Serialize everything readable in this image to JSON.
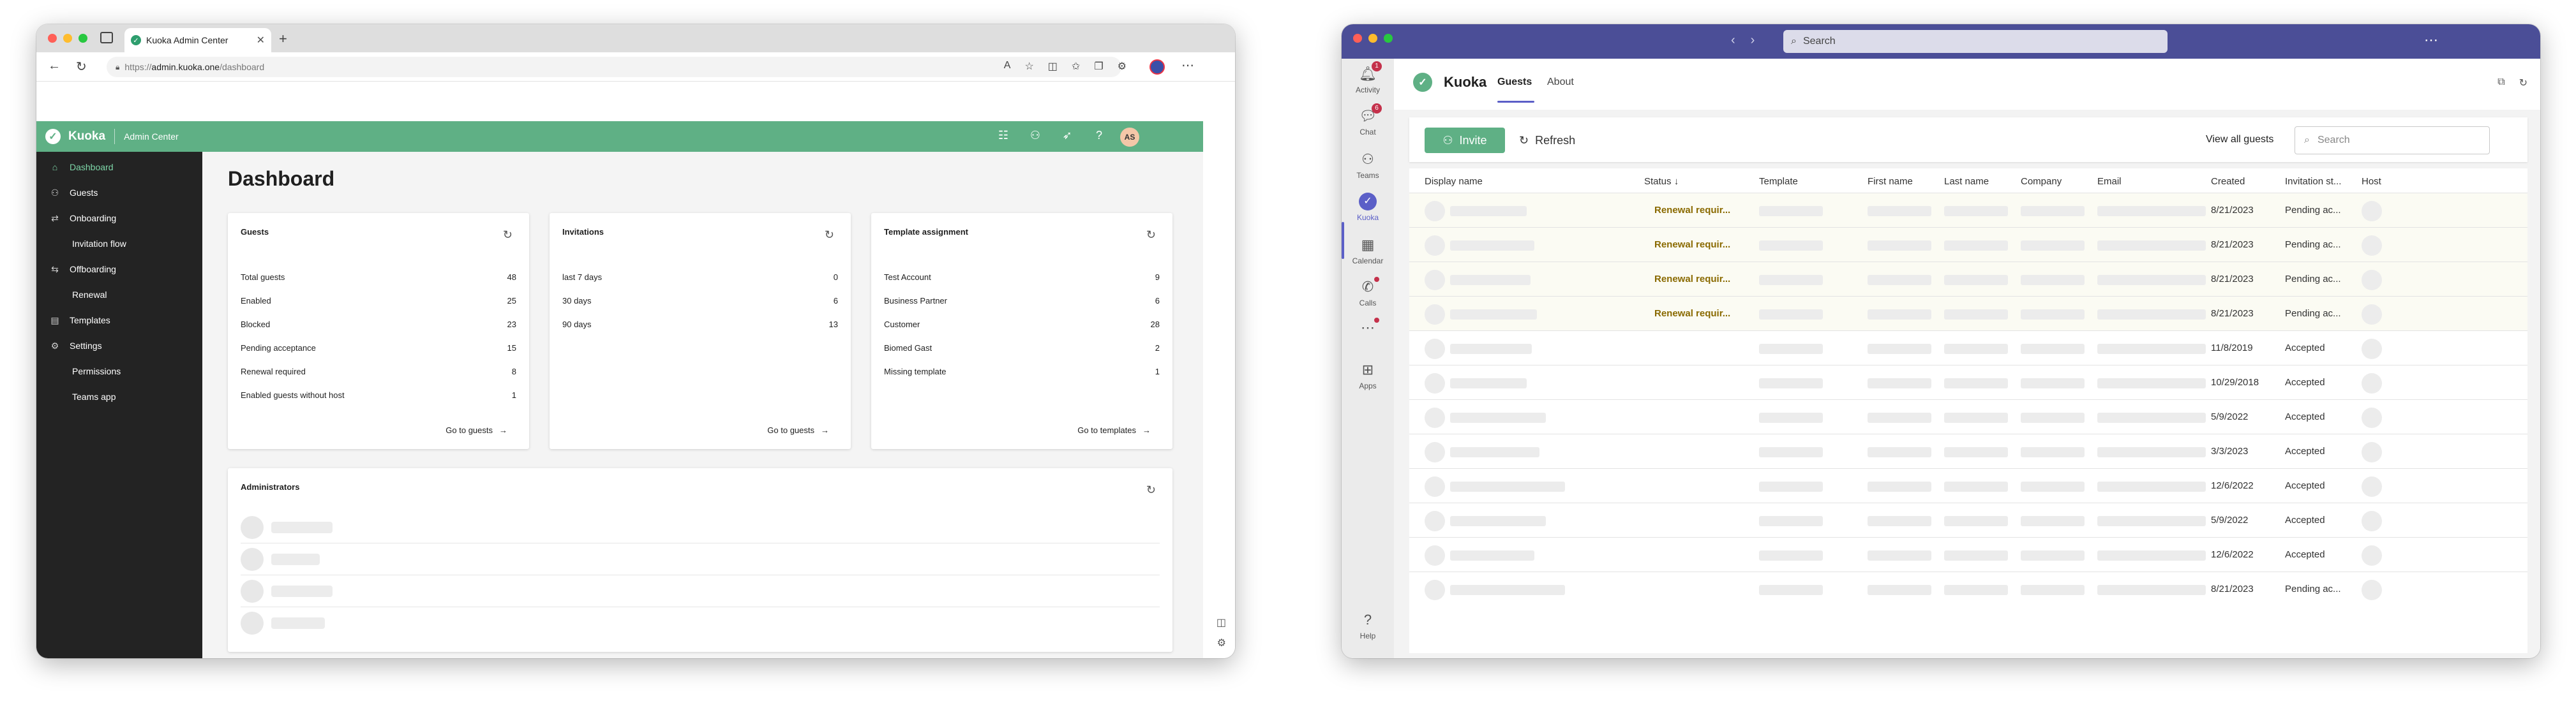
{
  "browser": {
    "tab_title": "Kuoka Admin Center",
    "url_protocol": "https://",
    "url_host": "admin.kuoka.one",
    "url_path": "/dashboard"
  },
  "admin": {
    "brand": "Kuoka",
    "subtitle": "Admin Center",
    "avatar_initials": "AS",
    "sidebar": [
      {
        "label": "Dashboard",
        "icon": "home-icon",
        "sub": false,
        "active": true
      },
      {
        "label": "Guests",
        "icon": "guests-icon",
        "sub": false,
        "active": false
      },
      {
        "label": "Onboarding",
        "icon": "onboarding-icon",
        "sub": false,
        "active": false
      },
      {
        "label": "Invitation flow",
        "icon": "",
        "sub": true,
        "active": false
      },
      {
        "label": "Offboarding",
        "icon": "offboarding-icon",
        "sub": false,
        "active": false
      },
      {
        "label": "Renewal",
        "icon": "",
        "sub": true,
        "active": false
      },
      {
        "label": "Templates",
        "icon": "templates-icon",
        "sub": false,
        "active": false
      },
      {
        "label": "Settings",
        "icon": "gear-icon",
        "sub": false,
        "active": false
      },
      {
        "label": "Permissions",
        "icon": "",
        "sub": true,
        "active": false
      },
      {
        "label": "Teams app",
        "icon": "",
        "sub": true,
        "active": false
      }
    ],
    "page_title": "Dashboard",
    "cards": [
      {
        "title": "Guests",
        "rows": [
          {
            "label": "Total guests",
            "value": "48"
          },
          {
            "label": "Enabled",
            "value": "25"
          },
          {
            "label": "Blocked",
            "value": "23"
          },
          {
            "label": "Pending acceptance",
            "value": "15"
          },
          {
            "label": "Renewal required",
            "value": "8"
          },
          {
            "label": "Enabled guests without host",
            "value": "1"
          }
        ],
        "link": "Go to guests"
      },
      {
        "title": "Invitations",
        "rows": [
          {
            "label": "last 7 days",
            "value": "0"
          },
          {
            "label": "30 days",
            "value": "6"
          },
          {
            "label": "90 days",
            "value": "13"
          }
        ],
        "link": "Go to guests"
      },
      {
        "title": "Template assignment",
        "rows": [
          {
            "label": "Test Account",
            "value": "9"
          },
          {
            "label": "Business Partner",
            "value": "6"
          },
          {
            "label": "Customer",
            "value": "28"
          },
          {
            "label": "Biomed Gast",
            "value": "2"
          },
          {
            "label": "Missing template",
            "value": "1"
          }
        ],
        "link": "Go to templates"
      }
    ],
    "administrators_title": "Administrators"
  },
  "teams": {
    "search_placeholder": "Search",
    "rail": [
      {
        "label": "Activity",
        "icon": "bell-icon",
        "badge": "1"
      },
      {
        "label": "Chat",
        "icon": "chat-icon",
        "badge": "6"
      },
      {
        "label": "Teams",
        "icon": "teams-icon",
        "badge": ""
      },
      {
        "label": "Kuoka",
        "icon": "kuoka-icon",
        "badge": ""
      },
      {
        "label": "Calendar",
        "icon": "calendar-icon",
        "badge": ""
      },
      {
        "label": "Calls",
        "icon": "phone-icon",
        "badge": ""
      },
      {
        "label": "",
        "icon": "more-icon",
        "badge": ""
      },
      {
        "label": "Apps",
        "icon": "apps-icon",
        "badge": ""
      }
    ],
    "help_label": "Help",
    "app_name": "Kuoka",
    "tabs": [
      "Guests",
      "About"
    ],
    "invite_label": "Invite",
    "refresh_label": "Refresh",
    "view_all_label": "View all guests",
    "table_search_placeholder": "Search",
    "columns": [
      "Display name",
      "Status ↓",
      "Template",
      "First name",
      "Last name",
      "Company",
      "Email",
      "Created",
      "Invitation st...",
      "Host"
    ],
    "rows": [
      {
        "status": "Renewal requir...",
        "created": "8/21/2023",
        "invitation": "Pending ac..."
      },
      {
        "status": "Renewal requir...",
        "created": "8/21/2023",
        "invitation": "Pending ac..."
      },
      {
        "status": "Renewal requir...",
        "created": "8/21/2023",
        "invitation": "Pending ac..."
      },
      {
        "status": "Renewal requir...",
        "created": "8/21/2023",
        "invitation": "Pending ac..."
      },
      {
        "status": "",
        "created": "11/8/2019",
        "invitation": "Accepted"
      },
      {
        "status": "",
        "created": "10/29/2018",
        "invitation": "Accepted"
      },
      {
        "status": "",
        "created": "5/9/2022",
        "invitation": "Accepted"
      },
      {
        "status": "",
        "created": "3/3/2023",
        "invitation": "Accepted"
      },
      {
        "status": "",
        "created": "12/6/2022",
        "invitation": "Accepted"
      },
      {
        "status": "",
        "created": "5/9/2022",
        "invitation": "Accepted"
      },
      {
        "status": "",
        "created": "12/6/2022",
        "invitation": "Accepted"
      },
      {
        "status": "",
        "created": "8/21/2023",
        "invitation": "Pending ac..."
      }
    ]
  }
}
